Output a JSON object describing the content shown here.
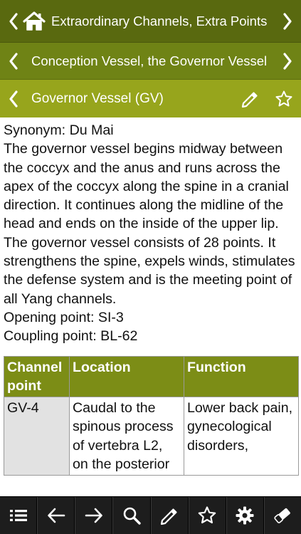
{
  "nav": {
    "level1_title": "Extraordinary Channels, Extra Points",
    "level2_title": "Conception Vessel, the Governor Vessel",
    "level3_title": "Governor Vessel (GV)"
  },
  "content": {
    "synonym": "Synonym: Du Mai",
    "description": "The governor vessel begins midway between the coccyx and the anus and runs across the apex of the coccyx along the spine in a cranial direction. It continues along the midline of the head and ends on the inside of the upper lip. The governor vessel consists of 28 points. It strengthens the spine, expels winds, stimulates the defense system and is the meeting point of all Yang channels.",
    "opening_point": "Opening point: SI-3",
    "coupling_point": "Coupling point: BL-62"
  },
  "table": {
    "headers": [
      "Channel point",
      "Location",
      "Function"
    ],
    "rows": [
      [
        "GV-4",
        "Caudal to the spinous process of vertebra L2, on the posterior",
        "Lower back pain, gynecological disorders,"
      ]
    ]
  },
  "icons": {
    "nav": [
      "chevron-left-icon",
      "home-icon",
      "chevron-right-icon",
      "pencil-icon",
      "star-icon"
    ],
    "toolbar": [
      "list-icon",
      "arrow-left-icon",
      "arrow-right-icon",
      "search-icon",
      "pencil-icon",
      "star-icon",
      "gear-icon",
      "eraser-icon"
    ]
  },
  "colors": {
    "nav1": "#59690f",
    "nav2": "#6f8315",
    "nav3": "#97a51c",
    "table_header": "#7c8d16",
    "toolbar": "#1d1d1d"
  }
}
